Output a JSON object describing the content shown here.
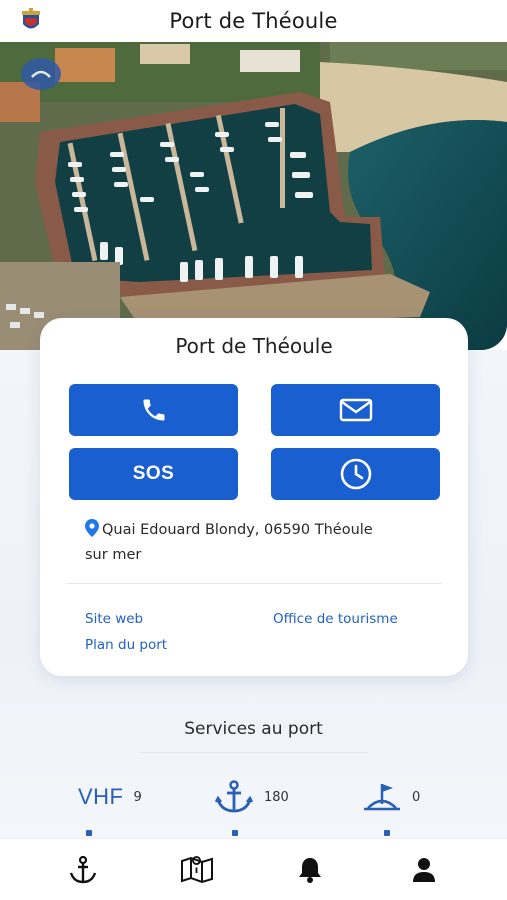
{
  "header": {
    "title": "Port de Théoule",
    "crest_icon": "crest-icon"
  },
  "hero": {
    "image": "aerial-photo-of-marina",
    "badge_icon": "compass-badge-icon"
  },
  "card": {
    "title": "Port de Théoule",
    "actions": [
      {
        "name": "call",
        "icon": "phone-icon"
      },
      {
        "name": "email",
        "icon": "mail-icon"
      },
      {
        "name": "sos",
        "label": "SOS"
      },
      {
        "name": "hours",
        "icon": "clock-icon"
      }
    ],
    "address_line1": "Quai Edouard Blondy, 06590 Théoule",
    "address_line2": "sur mer",
    "links": {
      "website": "Site web",
      "tourism": "Office de tourisme",
      "harbor_map": "Plan du port"
    }
  },
  "services": {
    "title": "Services au port",
    "vhf_label": "VHF",
    "vhf_value": "9",
    "moorings_value": "180",
    "visitor_value": "0"
  },
  "bottom_nav": [
    {
      "name": "anchor",
      "icon": "anchor-icon"
    },
    {
      "name": "map",
      "icon": "map-icon"
    },
    {
      "name": "notifications",
      "icon": "bell-icon"
    },
    {
      "name": "profile",
      "icon": "user-icon"
    }
  ],
  "colors": {
    "primary": "#1a5fd0",
    "link": "#2361c6",
    "accent_icon": "#2a5fb5",
    "sea": "#0f4f54",
    "background": "#f2f5fa"
  }
}
